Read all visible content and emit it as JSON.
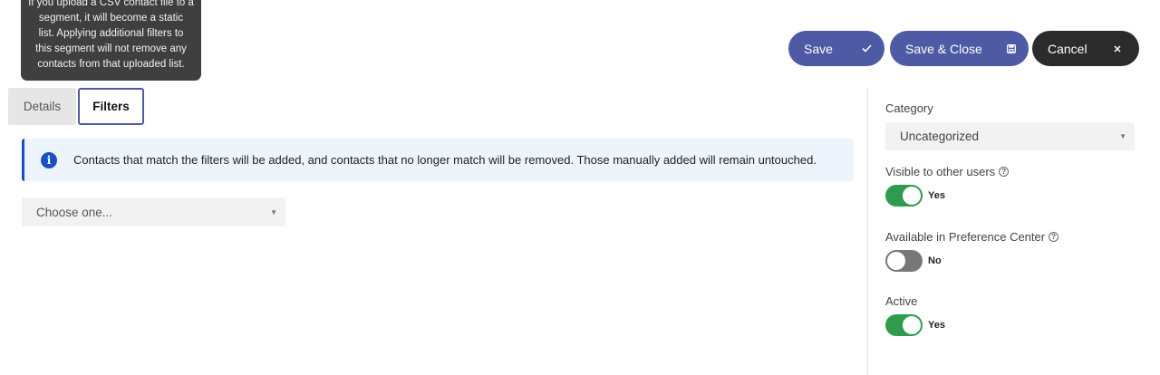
{
  "tooltip": {
    "line1": "If you upload a CSV contact file to a",
    "line2": "segment, it will become a static",
    "line3": "list. Applying additional filters to",
    "line4": "this segment will not remove any",
    "line5": "contacts from that uploaded list."
  },
  "toolbar": {
    "save_label": "Save",
    "save_close_label": "Save & Close",
    "cancel_label": "Cancel"
  },
  "tabs": [
    {
      "label": "Details"
    },
    {
      "label": "Filters"
    }
  ],
  "info": {
    "text": "Contacts that match the filters will be added, and contacts that no longer match will be removed. Those manually added will remain untouched."
  },
  "filter_select": {
    "value": "Choose one..."
  },
  "sidebar": {
    "category_label": "Category",
    "category_value": "Uncategorized",
    "visible_label": "Visible to other users",
    "visible_state": "Yes",
    "pref_label": "Available in Preference Center",
    "pref_state": "No",
    "active_label": "Active",
    "active_state": "Yes"
  },
  "colors": {
    "primary": "#4e5aa3",
    "dark": "#2b2b2b",
    "toggle_on": "#2e9b4e",
    "toggle_off": "#777777",
    "info_accent": "#1a4fc4"
  }
}
